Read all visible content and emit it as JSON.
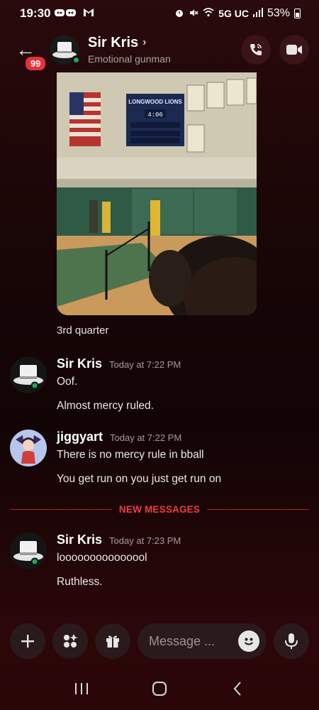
{
  "status_bar": {
    "time": "19:30",
    "network": "5G UC",
    "battery": "53%"
  },
  "header": {
    "unread_count": "99",
    "name": "Sir Kris",
    "status": "Emotional gunman"
  },
  "attachment": {
    "scoreboard_title": "LONGWOOD LIONS",
    "scoreboard_clock": "4:06",
    "caption": "3rd quarter"
  },
  "messages": [
    {
      "author": "Sir Kris",
      "time": "Today at 7:22 PM",
      "lines": [
        "Oof.",
        "Almost mercy ruled."
      ]
    },
    {
      "author": "jiggyart",
      "time": "Today at 7:22 PM",
      "lines": [
        "There is no mercy rule in bball",
        "You get run on you just get run on"
      ]
    },
    {
      "author": "Sir Kris",
      "time": "Today at 7:23 PM",
      "lines": [
        "looooooooooooool",
        "Ruthless."
      ]
    }
  ],
  "new_messages_label": "NEW MESSAGES",
  "composer": {
    "placeholder": "Message ..."
  },
  "colors": {
    "accent_red": "#ef3b46",
    "online_green": "#23a55a",
    "badge_red": "#e8313c"
  }
}
